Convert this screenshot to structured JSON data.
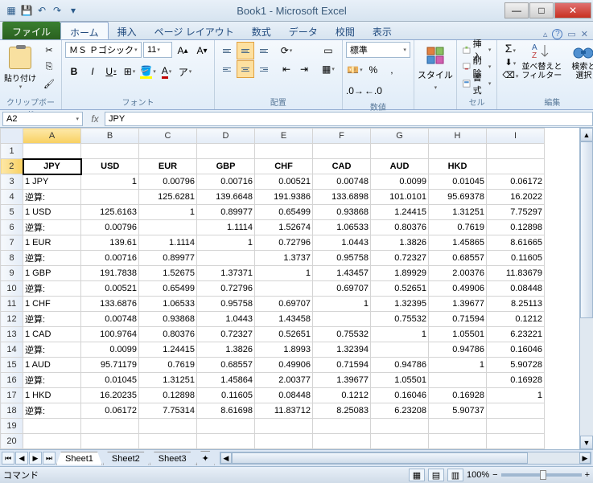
{
  "titlebar": {
    "title": "Book1 - Microsoft Excel"
  },
  "tabs": {
    "file": "ファイル",
    "home": "ホーム",
    "insert": "挿入",
    "pagelayout": "ページ レイアウト",
    "formulas": "数式",
    "data": "データ",
    "review": "校閲",
    "view": "表示"
  },
  "ribbon": {
    "clipboard": {
      "label": "クリップボード",
      "paste": "貼り付け"
    },
    "font": {
      "label": "フォント",
      "name": "ＭＳ Ｐゴシック",
      "size": "11"
    },
    "alignment": {
      "label": "配置"
    },
    "number": {
      "label": "数値",
      "format": "標準"
    },
    "styles": {
      "label": "スタイル"
    },
    "cells": {
      "label": "セル",
      "insert": "挿入",
      "delete": "削除",
      "format": "書式"
    },
    "editing": {
      "label": "編集",
      "sort": "並べ替えと\nフィルター",
      "find": "検索と\n選択"
    }
  },
  "namebox": "A2",
  "formula": "JPY",
  "columns": [
    "A",
    "B",
    "C",
    "D",
    "E",
    "F",
    "G",
    "H",
    "I"
  ],
  "headers": [
    "JPY",
    "USD",
    "EUR",
    "GBP",
    "CHF",
    "CAD",
    "AUD",
    "HKD"
  ],
  "rows": [
    {
      "label": "1 JPY",
      "vals": [
        "",
        "0.00796",
        "0.00716",
        "0.00521",
        "0.00748",
        "0.0099",
        "0.01045",
        "0.06172"
      ]
    },
    {
      "label": "逆算:",
      "vals": [
        "",
        "125.6281",
        "139.6648",
        "191.9386",
        "133.6898",
        "101.0101",
        "95.69378",
        "16.2022"
      ]
    },
    {
      "label": "1 USD",
      "vals": [
        "125.6163",
        "",
        "0.89977",
        "0.65499",
        "0.93868",
        "1.24415",
        "1.31251",
        "7.75297"
      ]
    },
    {
      "label": "逆算:",
      "vals": [
        "0.00796",
        "",
        "1.1114",
        "1.52674",
        "1.06533",
        "0.80376",
        "0.7619",
        "0.12898"
      ]
    },
    {
      "label": "1 EUR",
      "vals": [
        "139.61",
        "1.1114",
        "",
        "0.72796",
        "1.0443",
        "1.3826",
        "1.45865",
        "8.61665"
      ]
    },
    {
      "label": "逆算:",
      "vals": [
        "0.00716",
        "0.89977",
        "",
        "1.3737",
        "0.95758",
        "0.72327",
        "0.68557",
        "0.11605"
      ]
    },
    {
      "label": "1 GBP",
      "vals": [
        "191.7838",
        "1.52675",
        "1.37371",
        "",
        "1.43457",
        "1.89929",
        "2.00376",
        "11.83679"
      ]
    },
    {
      "label": "逆算:",
      "vals": [
        "0.00521",
        "0.65499",
        "0.72796",
        "",
        "0.69707",
        "0.52651",
        "0.49906",
        "0.08448"
      ]
    },
    {
      "label": "1 CHF",
      "vals": [
        "133.6876",
        "1.06533",
        "0.95758",
        "0.69707",
        "",
        "1.32395",
        "1.39677",
        "8.25113"
      ]
    },
    {
      "label": "逆算:",
      "vals": [
        "0.00748",
        "0.93868",
        "1.0443",
        "1.43458",
        "",
        "0.75532",
        "0.71594",
        "0.1212"
      ]
    },
    {
      "label": "1 CAD",
      "vals": [
        "100.9764",
        "0.80376",
        "0.72327",
        "0.52651",
        "0.75532",
        "",
        "1.05501",
        "6.23221"
      ]
    },
    {
      "label": "逆算:",
      "vals": [
        "0.0099",
        "1.24415",
        "1.3826",
        "1.8993",
        "1.32394",
        "",
        "0.94786",
        "0.16046"
      ]
    },
    {
      "label": "1 AUD",
      "vals": [
        "95.71179",
        "0.7619",
        "0.68557",
        "0.49906",
        "0.71594",
        "0.94786",
        "",
        "5.90728"
      ]
    },
    {
      "label": "逆算:",
      "vals": [
        "0.01045",
        "1.31251",
        "1.45864",
        "2.00377",
        "1.39677",
        "1.05501",
        "",
        "0.16928"
      ]
    },
    {
      "label": "1 HKD",
      "vals": [
        "16.20235",
        "0.12898",
        "0.11605",
        "0.08448",
        "0.1212",
        "0.16046",
        "0.16928",
        ""
      ]
    },
    {
      "label": "逆算:",
      "vals": [
        "0.06172",
        "7.75314",
        "8.61698",
        "11.83712",
        "8.25083",
        "6.23208",
        "5.90737",
        ""
      ]
    }
  ],
  "diag_one": "1",
  "sheets": {
    "s1": "Sheet1",
    "s2": "Sheet2",
    "s3": "Sheet3"
  },
  "status": {
    "mode": "コマンド",
    "zoom": "100%"
  }
}
